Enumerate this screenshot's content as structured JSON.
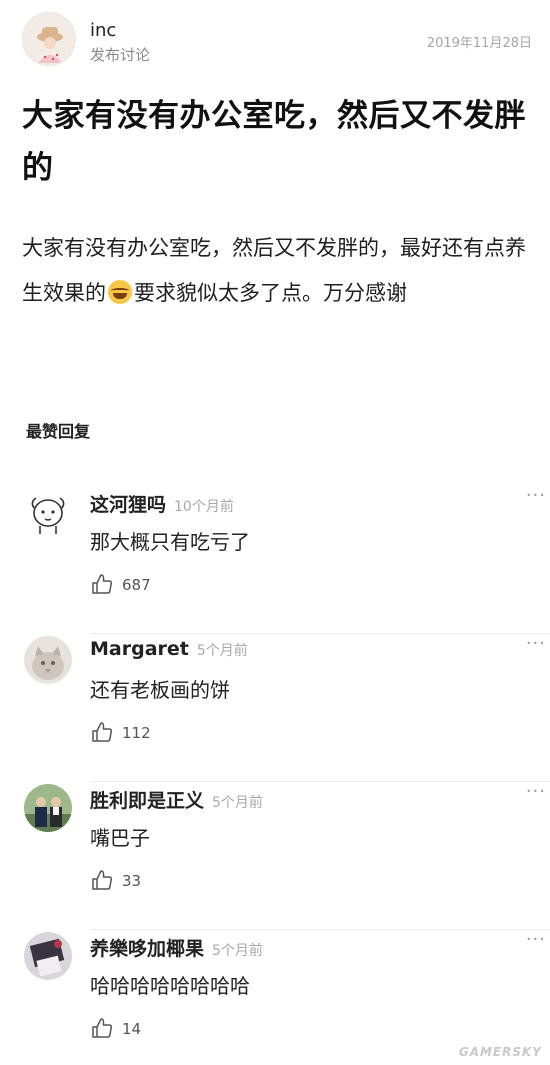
{
  "post": {
    "author": "inc",
    "author_sub": "发布讨论",
    "date": "2019年11月28日",
    "title": "大家有没有办公室吃，然后又不发胖的",
    "body_part1": "大家有没有办公室吃，然后又不发胖的，最好还有点养生效果的",
    "body_emoji": "laughing-tears-emoji",
    "body_part2": "要求貌似太多了点。万分感谢"
  },
  "section_label": "最赞回复",
  "replies": [
    {
      "name": "这河狸吗",
      "time": "10个月前",
      "text": "那大概只有吃亏了",
      "likes": "687"
    },
    {
      "name": "Margaret",
      "time": "5个月前",
      "text": "还有老板画的饼",
      "likes": "112"
    },
    {
      "name": "胜利即是正义",
      "time": "5个月前",
      "text": "嘴巴子",
      "likes": "33"
    },
    {
      "name": "养樂哆加椰果",
      "time": "5个月前",
      "text": "哈哈哈哈哈哈哈哈",
      "likes": "14"
    }
  ],
  "more_glyph": "···",
  "watermark": "GAMERSKY"
}
